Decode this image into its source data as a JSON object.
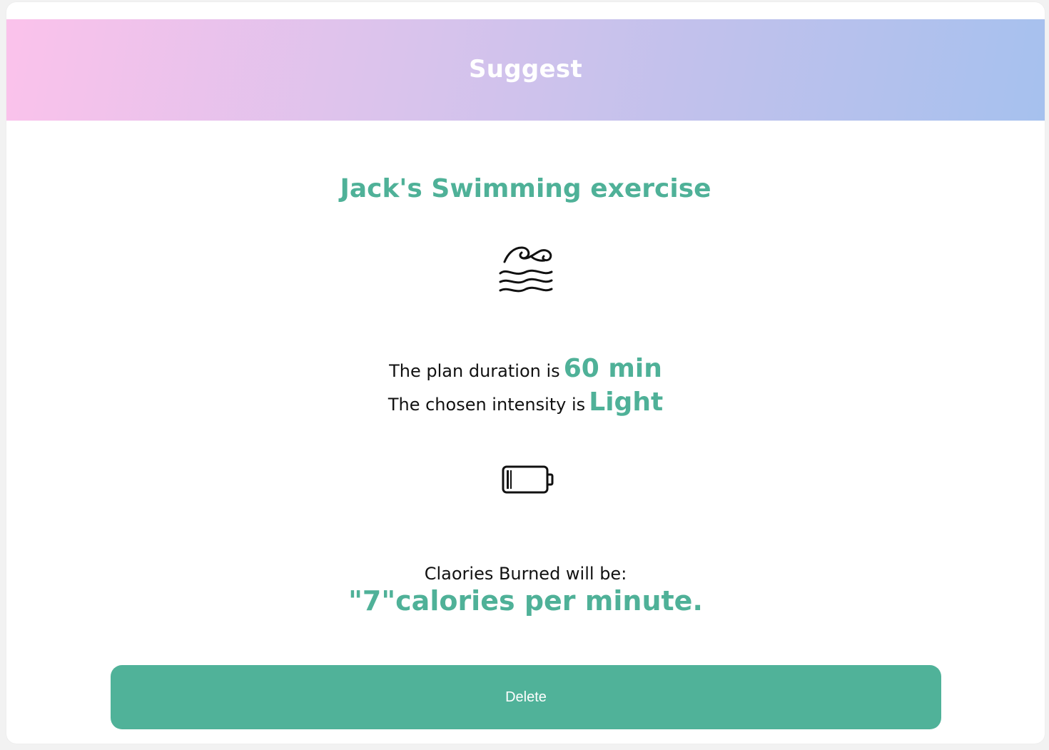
{
  "header": {
    "title": "Suggest"
  },
  "exercise": {
    "title": "Jack's Swimming exercise",
    "icon": "waves-icon"
  },
  "details": {
    "duration_label": "The plan duration is",
    "duration_value": "60 min",
    "intensity_label": "The chosen intensity is",
    "intensity_value": "Light",
    "intensity_icon": "battery-low-icon"
  },
  "calories": {
    "label": "Claories Burned will be:",
    "value": "\"7\"calories per minute."
  },
  "actions": {
    "delete_label": "Delete"
  },
  "colors": {
    "accent": "#4fb198",
    "button": "#50b299",
    "header_gradient_start": "#fbc2eb",
    "header_gradient_end": "#a6c1ee"
  }
}
